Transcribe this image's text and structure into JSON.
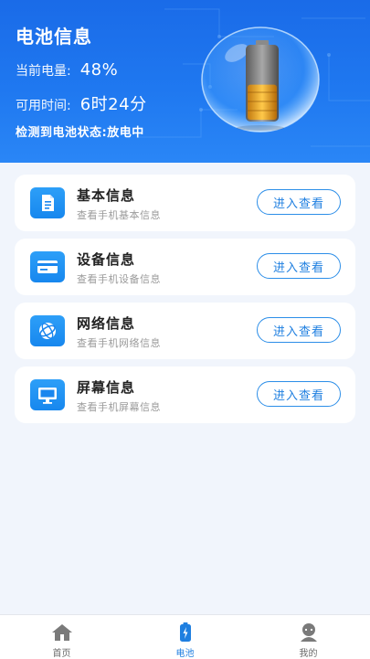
{
  "header": {
    "title": "电池信息",
    "level_label": "当前电量:",
    "level_value": "48%",
    "time_label": "可用时间:",
    "time_value": "6时24分",
    "status_text": "检测到电池状态:放电中",
    "battery_level": 0.48
  },
  "cards": [
    {
      "title": "基本信息",
      "subtitle": "查看手机基本信息",
      "button": "进入查看",
      "icon": "document-icon"
    },
    {
      "title": "设备信息",
      "subtitle": "查看手机设备信息",
      "button": "进入查看",
      "icon": "card-icon"
    },
    {
      "title": "网络信息",
      "subtitle": "查看手机网络信息",
      "button": "进入查看",
      "icon": "globe-icon"
    },
    {
      "title": "屏幕信息",
      "subtitle": "查看手机屏幕信息",
      "button": "进入查看",
      "icon": "monitor-icon"
    }
  ],
  "tabbar": {
    "items": [
      {
        "label": "首页",
        "icon": "home-icon"
      },
      {
        "label": "电池",
        "icon": "battery-icon"
      },
      {
        "label": "我的",
        "icon": "user-icon"
      }
    ],
    "active_index": 1
  },
  "colors": {
    "accent": "#1f7fe0",
    "hero": "#1a6be8",
    "background": "#f1f5fc"
  }
}
